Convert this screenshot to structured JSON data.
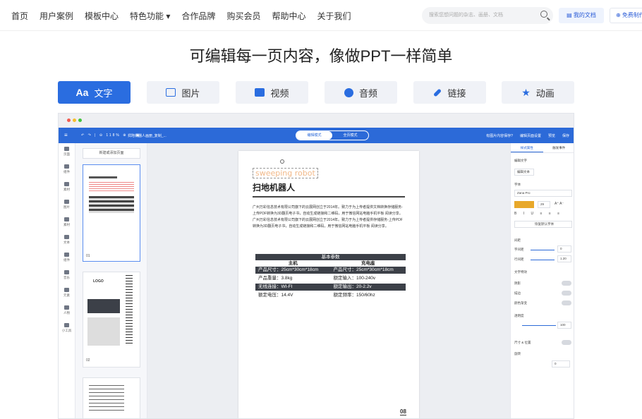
{
  "nav": {
    "links": [
      "首页",
      "用户案例",
      "模板中心",
      "特色功能",
      "合作品牌",
      "购买会员",
      "帮助中心",
      "关于我们"
    ],
    "search_placeholder": "搜索您想问题的杂志、画册、文档",
    "my_docs": "我的文档",
    "free": "免费制作"
  },
  "headline": "可编辑每一页内容，像做PPT一样简单",
  "tabs": [
    "文字",
    "图片",
    "视频",
    "音频",
    "链接",
    "动画"
  ],
  "tab_prefix": "Aa",
  "editor": {
    "doc_name": "扫地机器人画册_复制_...",
    "mode_edit": "编辑模式",
    "mode_preview": "全页模式",
    "right_actions": [
      "有图片内容保存?",
      "编辑页面设置",
      "预览",
      "保存"
    ],
    "rail": [
      "页面",
      "组件",
      "素材",
      "图片",
      "素材",
      "文本",
      "组件",
      "音乐",
      "元素",
      "人物",
      "小工具"
    ],
    "add_page": "新建或添加页面",
    "page1_num": "01",
    "page2_num": "02",
    "thumb2_logo": "LOGO",
    "watermark": "sweeping robot",
    "title": "扫地机器人",
    "body": "广州万彩信息技术有限公司旗下的云展网创立于2014年。致力于为上传者提供文档转换存储服务-上传PDF转换为3D翻页电子书，自动生成链接和二维码，用于微信网站电脑手机平板 阅读分享。广州万彩信息技术有限公司旗下的云展网创立于2014年。致力于为上传者提供存储服务-上传PDF转换为3D翻页电子书，自动生成链接和二维码，用于微信网站电脑手机平板 阅读分享。",
    "spec_header": "基本参数",
    "spec_col1": "主机",
    "spec_col2": "充电座",
    "spec_rows": [
      [
        "产品尺寸：25cm*30cm*18cm",
        "产品尺寸：25cm*30cm*18cm"
      ],
      [
        "产品重量：3.8kg",
        "额定输入：100-240v"
      ],
      [
        "无线连接：WI-FI",
        "额定输出：20-2.2v"
      ],
      [
        "额定电压：14.4V",
        "额定频率：150/60hz"
      ]
    ],
    "page_number": "08",
    "panel": {
      "tab1": "样式属性",
      "tab2": "触发事件",
      "edit_text": "编辑文字",
      "edit_btn": "编辑文本",
      "font_label": "字体",
      "font": "Zana Pro",
      "size": "29",
      "more": "恢复默认字体",
      "spacing": "间距",
      "letter": "字间距",
      "letter_val": "0",
      "line": "行间距",
      "line_val": "1.20",
      "text_effect": "文字特效",
      "shadow": "阴影",
      "stroke": "描边",
      "gradient": "颜色渐变",
      "opacity": "透明度",
      "opacity_val": "100",
      "size_pos": "尺寸 & 位置",
      "rotate": "旋转",
      "rotate_val": "0"
    }
  }
}
